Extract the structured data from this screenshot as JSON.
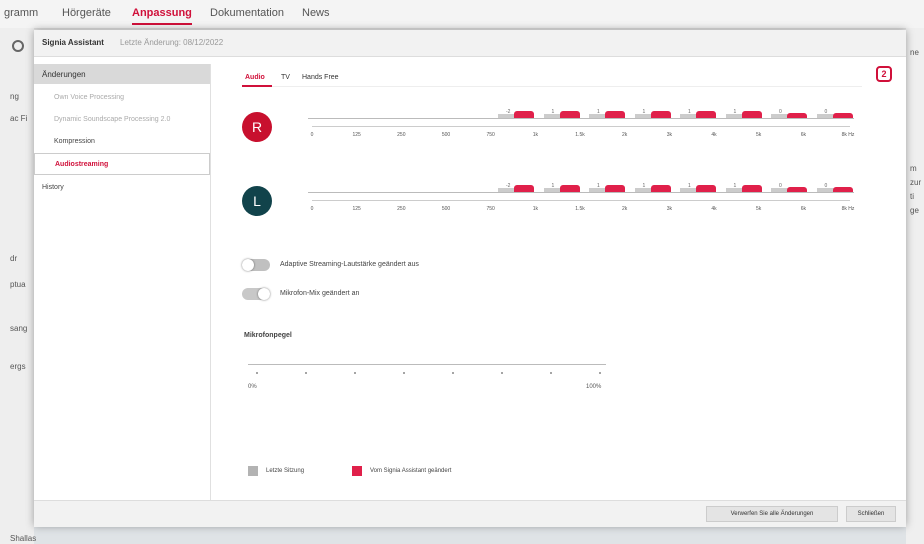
{
  "app": {
    "tabs": [
      "gramm",
      "Hörgeräte",
      "Anpassung",
      "Dokumentation",
      "News"
    ],
    "active_tab": "Anpassung",
    "left_fragments": [
      "ng",
      "ac Fi",
      "dr",
      "ptua",
      "sang",
      "ergs"
    ],
    "right_fragments": [
      "ne",
      "m",
      "zur",
      "ti",
      "ge"
    ],
    "bottom_fragment": "Shallas"
  },
  "dialog": {
    "title": "Signia Assistant",
    "subtitle": "Letzte Änderung: 08/12/2022",
    "sidebar": {
      "header": "Änderungen",
      "items": [
        "Own Voice Processing",
        "Dynamic Soundscape Processing 2.0",
        "Kompression"
      ],
      "active_item": "Audiostreaming",
      "history": "History"
    },
    "tabs": [
      "Audio",
      "TV",
      "Hands Free"
    ],
    "active_tab": "Audio",
    "assistant_icon": "signia-assistant-icon",
    "right_ear": {
      "label": "R",
      "levels": [
        "-2",
        "1",
        "1",
        "1",
        "1",
        "1",
        "0",
        "0"
      ],
      "freq_labels": [
        "0",
        "125",
        "250",
        "500",
        "750",
        "1k",
        "1.5k",
        "2k",
        "3k",
        "4k",
        "5k",
        "6k",
        "8k Hz"
      ]
    },
    "left_ear": {
      "label": "L",
      "levels": [
        "-2",
        "1",
        "1",
        "1",
        "1",
        "1",
        "0",
        "0"
      ],
      "freq_labels": [
        "0",
        "125",
        "250",
        "500",
        "750",
        "1k",
        "1.5k",
        "2k",
        "3k",
        "4k",
        "5k",
        "6k",
        "8k Hz"
      ]
    },
    "toggles": [
      {
        "label": "Adaptive Streaming-Lautstärke geändert aus",
        "on": false
      },
      {
        "label": "Mikrofon-Mix geändert an",
        "on": true
      }
    ],
    "mic_level": {
      "title": "Mikrofonpegel",
      "min": "0%",
      "max": "100%"
    },
    "legend": [
      {
        "label": "Letzte Sitzung",
        "color": "#b3b3b3"
      },
      {
        "label": "Vom Signia Assistant geändert",
        "color": "#e0204a"
      }
    ],
    "buttons": {
      "discard": "Verwerfen Sie alle Änderungen",
      "close": "Schließen"
    }
  },
  "colors": {
    "accent": "#d0103a",
    "right_ear": "#c8102e",
    "left_ear": "#11434b"
  }
}
